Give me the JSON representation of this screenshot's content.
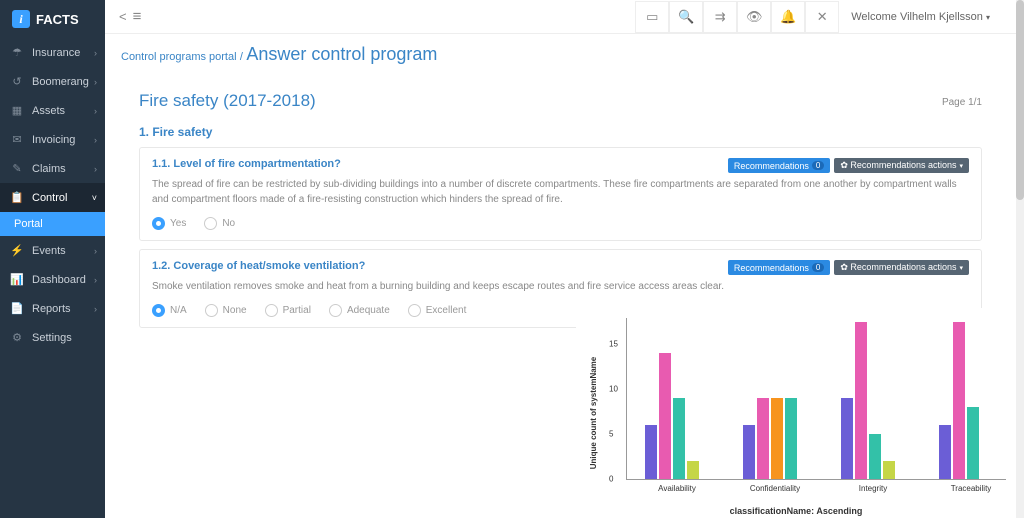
{
  "brand": "FACTS",
  "sidebar": [
    {
      "icon": "☂",
      "label": "Insurance"
    },
    {
      "icon": "↺",
      "label": "Boomerang"
    },
    {
      "icon": "▦",
      "label": "Assets"
    },
    {
      "icon": "✉",
      "label": "Invoicing"
    },
    {
      "icon": "✎",
      "label": "Claims"
    },
    {
      "icon": "📋",
      "label": "Control",
      "active": true,
      "expanded": true
    },
    {
      "icon": "",
      "label": "Portal",
      "sub": true
    },
    {
      "icon": "⚡",
      "label": "Events"
    },
    {
      "icon": "📊",
      "label": "Dashboard"
    },
    {
      "icon": "📄",
      "label": "Reports"
    },
    {
      "icon": "⚙",
      "label": "Settings",
      "noarrow": true
    }
  ],
  "topbar": {
    "welcome_prefix": "Welcome",
    "user": "Vilhelm Kjellsson"
  },
  "breadcrumb": {
    "parent": "Control programs portal",
    "current": "Answer control program"
  },
  "panel": {
    "title": "Fire safety (2017-2018)",
    "page": "Page 1/1",
    "section": "1. Fire safety"
  },
  "questions": [
    {
      "title": "1.1. Level of fire compartmentation?",
      "desc": "The spread of fire can be restricted by sub-dividing buildings into a number of discrete compartments. These fire compartments are separated from one another by compartment walls and compartment floors made of a fire-resisting construction which hinders the spread of fire.",
      "rec_label": "Recommendations",
      "rec_count": "0",
      "rec_actions": "Recommendations actions",
      "options": [
        "Yes",
        "No"
      ],
      "selected": 0
    },
    {
      "title": "1.2. Coverage of heat/smoke ventilation?",
      "desc": "Smoke ventilation removes smoke and heat from a burning building and keeps escape routes and fire service access areas clear.",
      "rec_label": "Recommendations",
      "rec_count": "0",
      "rec_actions": "Recommendations actions",
      "options": [
        "N/A",
        "None",
        "Partial",
        "Adequate",
        "Excellent"
      ],
      "selected": 0
    }
  ],
  "chart_data": {
    "type": "bar",
    "ylabel": "Unique count of systemName",
    "xlabel": "classificationName: Ascending",
    "categories": [
      "Availability",
      "Confidentiality",
      "Integrity",
      "Traceability"
    ],
    "yticks": [
      0,
      5,
      10,
      15
    ],
    "ylim": [
      0,
      18
    ],
    "colors": [
      "#6b5ed6",
      "#e85bb0",
      "#f7941e",
      "#33c1a8",
      "#c5d647"
    ],
    "series": [
      {
        "name": "s1",
        "values": [
          6,
          6,
          9,
          6
        ]
      },
      {
        "name": "s2",
        "values": [
          14,
          9,
          17.5,
          17.5
        ]
      },
      {
        "name": "s3",
        "values": [
          0,
          9,
          0,
          0
        ]
      },
      {
        "name": "s4",
        "values": [
          9,
          9,
          5,
          8
        ]
      },
      {
        "name": "s5",
        "values": [
          2,
          0,
          2,
          0
        ]
      }
    ]
  }
}
